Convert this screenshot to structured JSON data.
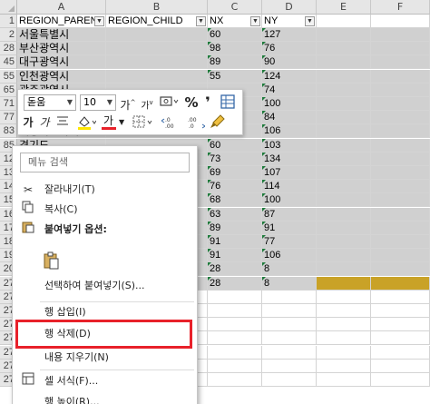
{
  "sheet": {
    "columns": [
      "A",
      "B",
      "C",
      "D",
      "E",
      "F"
    ],
    "headers": {
      "A": "REGION_PARENT",
      "B": "REGION_CHILD",
      "C": "NX",
      "D": "NY"
    },
    "header_row": "1",
    "rows": [
      {
        "num": "2",
        "a": "서울특별시",
        "c": "60",
        "d": "127"
      },
      {
        "num": "28",
        "a": "부산광역시",
        "c": "98",
        "d": "76"
      },
      {
        "num": "45",
        "a": "대구광역시",
        "c": "89",
        "d": "90"
      },
      {
        "num": "55",
        "a": "인천광역시",
        "c": "55",
        "d": "124"
      },
      {
        "num": "65",
        "a": "광주광역시",
        "c": "",
        "d": "74"
      },
      {
        "num": "71",
        "a": "대전광역시",
        "c": "",
        "d": "100"
      },
      {
        "num": "77",
        "a": "울산광역시",
        "c": "",
        "d": "84"
      },
      {
        "num": "83",
        "a": "세종특별자치시",
        "c": "",
        "d": "106"
      },
      {
        "num": "85",
        "a": "경기도",
        "c": "60",
        "d": "103"
      },
      {
        "num": "12",
        "a": "",
        "c": "73",
        "d": "134"
      },
      {
        "num": "13",
        "a": "",
        "c": "69",
        "d": "107"
      },
      {
        "num": "14",
        "a": "",
        "c": "76",
        "d": "114"
      },
      {
        "num": "15",
        "a": "",
        "c": "68",
        "d": "100"
      },
      {
        "num": "16",
        "a": "",
        "c": "63",
        "d": "87"
      },
      {
        "num": "17",
        "a": "",
        "c": "89",
        "d": "91"
      },
      {
        "num": "18",
        "a": "",
        "c": "91",
        "d": "77"
      },
      {
        "num": "19",
        "a": "",
        "c": "91",
        "d": "106"
      },
      {
        "num": "20",
        "a": "",
        "c": "28",
        "d": "8"
      },
      {
        "num": "27",
        "a": "",
        "c": "28",
        "d": "8"
      },
      {
        "num": "27",
        "a": "",
        "c": "",
        "d": ""
      },
      {
        "num": "27",
        "a": "",
        "c": "",
        "d": ""
      },
      {
        "num": "27",
        "a": "",
        "c": "",
        "d": ""
      },
      {
        "num": "27",
        "a": "",
        "c": "",
        "d": ""
      },
      {
        "num": "27",
        "a": "",
        "c": "",
        "d": ""
      },
      {
        "num": "27",
        "a": "",
        "c": "",
        "d": ""
      },
      {
        "num": "27",
        "a": "",
        "c": "",
        "d": ""
      }
    ]
  },
  "mini_toolbar": {
    "font_name": "돋움",
    "font_size": "10",
    "grow_font": "가",
    "shrink_font": "가",
    "percent": "%",
    "comma": "❜",
    "bold": "가",
    "italic": "가",
    "font_color_letter": "가"
  },
  "context_menu": {
    "search_placeholder": "메뉴 검색",
    "items": [
      {
        "label": "잘라내기(T)",
        "icon": "scissors-icon"
      },
      {
        "label": "복사(C)",
        "icon": "copy-icon"
      },
      {
        "label": "붙여넣기 옵션:",
        "icon": "paste-icon"
      },
      {
        "label": "선택하여 붙여넣기(S)...",
        "icon": ""
      },
      {
        "label": "행 삽입(I)",
        "icon": ""
      },
      {
        "label": "행 삭제(D)",
        "icon": ""
      },
      {
        "label": "내용 지우기(N)",
        "icon": ""
      },
      {
        "label": "셀 서식(F)...",
        "icon": "format-cells-icon"
      },
      {
        "label": "행 높이(R)...",
        "icon": ""
      }
    ]
  },
  "colors": {
    "selection": "#d0d0d0",
    "gold_fill": "#c9a227",
    "highlight_border": "#e8212a",
    "error_triangle": "#1d7a3a"
  }
}
